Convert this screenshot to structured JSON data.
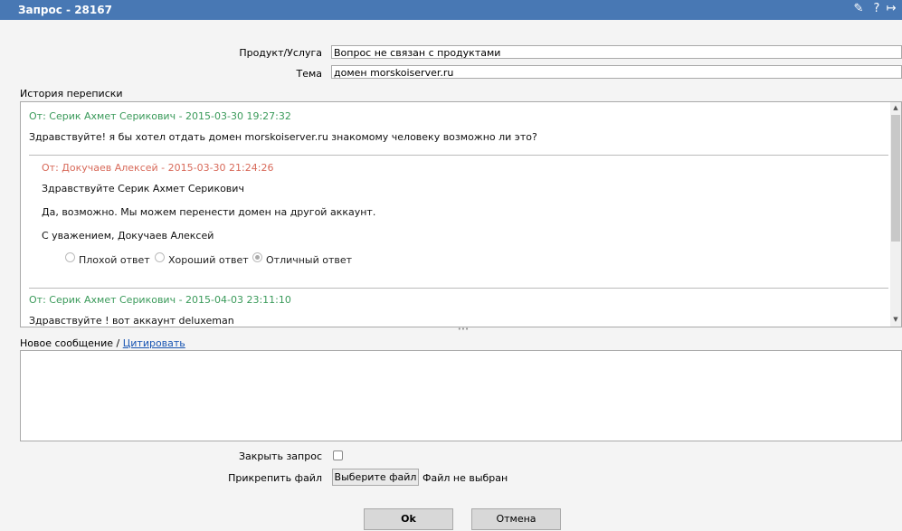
{
  "window": {
    "title": "Запрос - 28167",
    "controls": [
      "pin-icon",
      "help-icon",
      "exit-icon"
    ]
  },
  "form": {
    "product_label": "Продукт/Услуга",
    "product_value": "Вопрос не связан с продуктами",
    "subject_label": "Тема",
    "subject_value": "домен morskoiserver.ru",
    "history_label": "История переписки"
  },
  "history": {
    "messages": [
      {
        "header": "От: Серик Ахмет Серикович - 2015-03-30 19:27:32",
        "text": "Здравствуйте! я бы хотел отдать домен morskoiserver.ru знакомому человеку возможно ли это?"
      },
      {
        "header": "От: Докучаев Алексей - 2015-03-30 21:24:26",
        "lines": [
          "Здравствуйте Серик Ахмет Серикович",
          "Да, возможно. Мы можем перенести домен на другой аккаунт.",
          "С уважением, Докучаев Алексей"
        ],
        "rating": {
          "options": [
            "Плохой ответ",
            "Хороший ответ",
            "Отличный ответ"
          ],
          "selected": "Отличный ответ"
        }
      },
      {
        "header": "От: Серик Ахмет Серикович - 2015-04-03 23:11:10",
        "text": "Здравствуйте ! вот аккаунт deluxeman"
      }
    ]
  },
  "new_message": {
    "label": "Новое сообщение / ",
    "quote_link": "Цитировать",
    "value": ""
  },
  "close_request": {
    "label": "Закрыть запрос",
    "checked": false
  },
  "attach": {
    "label": "Прикрепить файл",
    "button": "Выберите файл",
    "status": "Файл не выбран"
  },
  "actions": {
    "ok": "Ok",
    "cancel": "Отмена"
  },
  "colors": {
    "titlebar": "#4878b4",
    "client_header": "#3a9a5a",
    "staff_header": "#d86a5a"
  }
}
